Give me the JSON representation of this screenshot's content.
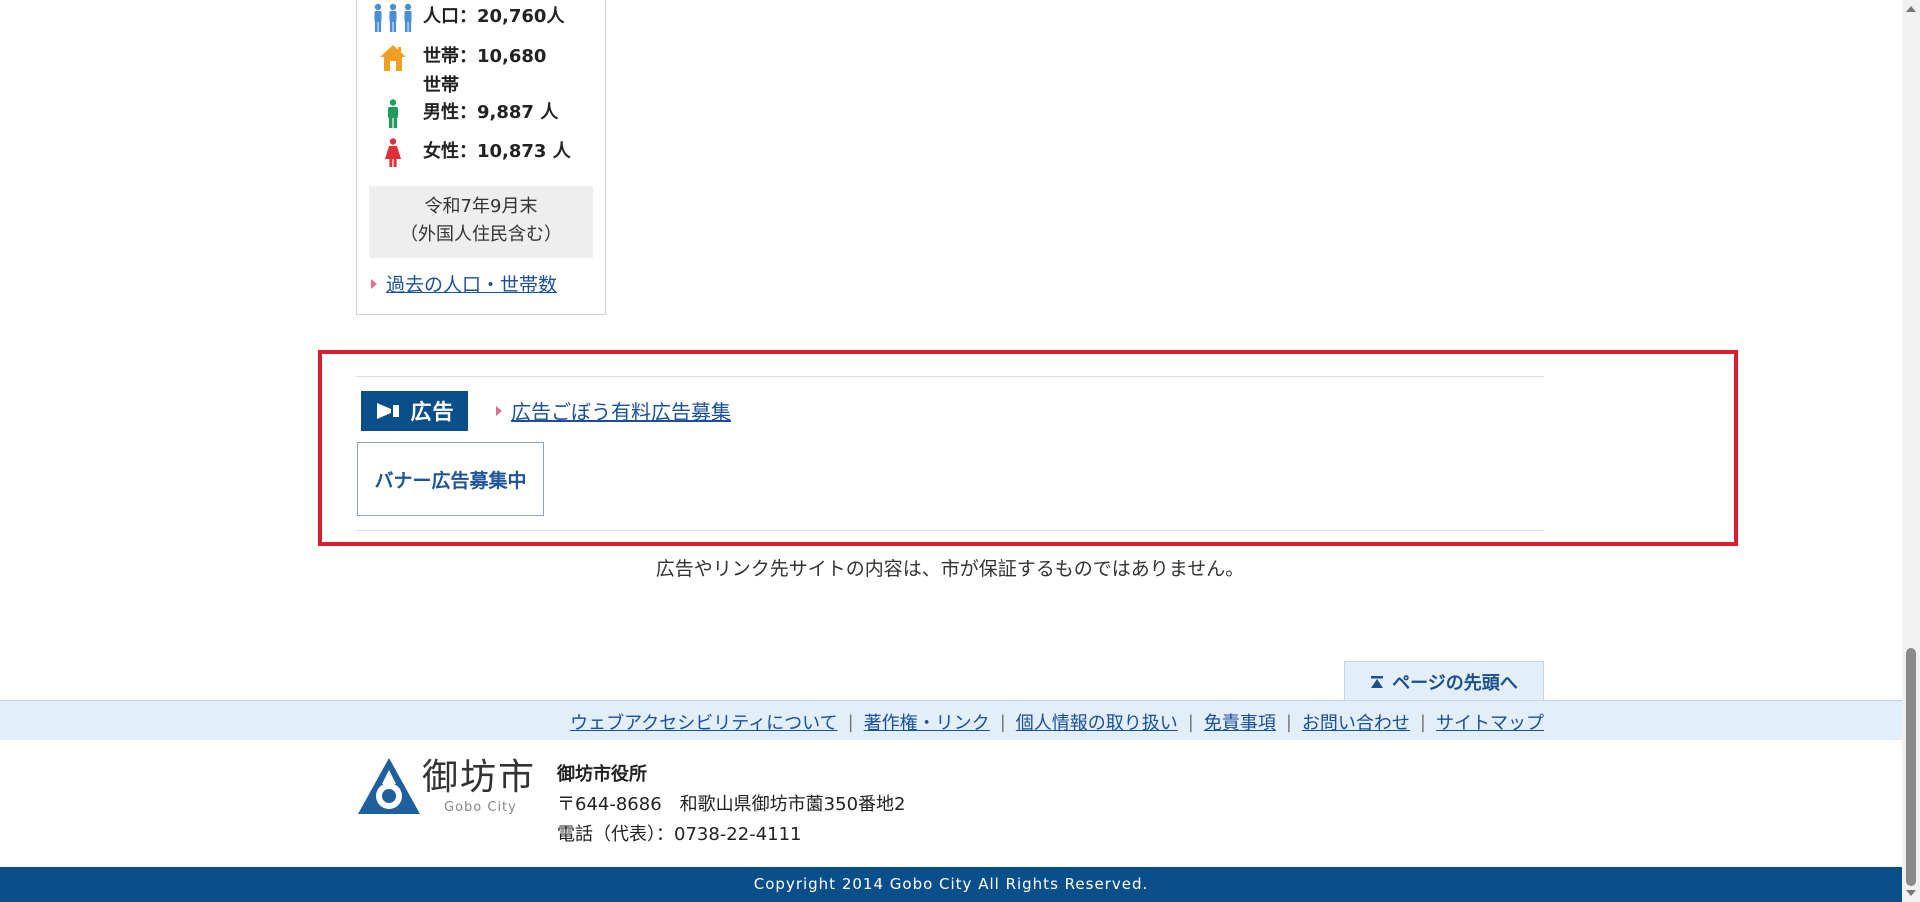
{
  "population": {
    "population_label": "人口：",
    "population_value": "20,760人",
    "households_label": "世帯：",
    "households_value": "10,680 世帯",
    "male_label": "男性：",
    "male_value": "9,887 人",
    "female_label": "女性：",
    "female_value": "10,873 人",
    "note_line1": "令和7年9月末",
    "note_line2": "（外国人住民含む）",
    "past_link": "過去の人口・世帯数"
  },
  "ads": {
    "badge_label": "広告",
    "recruit_link": "広告ごぼう有料広告募集",
    "banner_label": "バナー広告募集中",
    "disclaimer": "広告やリンク先サイトの内容は、市が保証するものではありません。"
  },
  "pagetop": {
    "label": "ページの先頭へ"
  },
  "footer_nav": {
    "items": [
      "ウェブアクセシビリティについて",
      "著作権・リンク",
      "個人情報の取り扱い",
      "免責事項",
      "お問い合わせ",
      "サイトマップ"
    ]
  },
  "footer": {
    "logo_name": "御坊市",
    "logo_sub": "Gobo City",
    "office_name": "御坊市役所",
    "address": "〒644-8686　和歌山県御坊市薗350番地2",
    "phone": "電話（代表）：0738-22-4111",
    "copyright": "Copyright 2014 Gobo City All Rights Reserved."
  },
  "colors": {
    "brand_blue": "#0b4f8a",
    "highlight_red": "#d6202c",
    "nav_bg": "#e2eef8",
    "link": "#1a4f9a"
  },
  "icons": {
    "population": "people-group-icon",
    "households": "house-icon",
    "male": "male-figure-icon",
    "female": "female-figure-icon",
    "ad": "megaphone-icon",
    "pagetop": "arrow-up-to-top-icon",
    "logo": "gobo-city-emblem"
  }
}
